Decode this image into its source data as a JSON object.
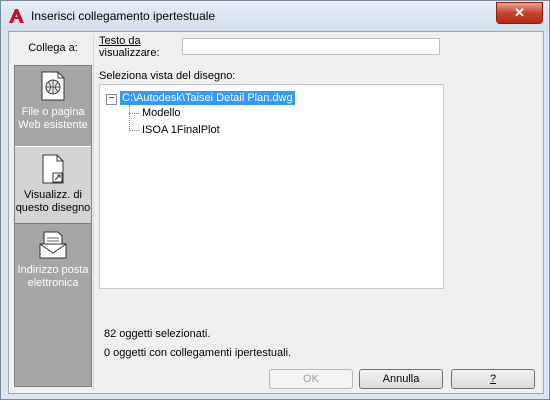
{
  "window": {
    "title": "Inserisci collegamento ipertestuale",
    "close_icon": "close-icon"
  },
  "left_panel": {
    "label": "Collega a:",
    "items": [
      {
        "label": "File o pagina Web esistente",
        "icon": "web-file-icon",
        "selected": false
      },
      {
        "label": "Visualizz. di questo disegno",
        "icon": "drawing-view-icon",
        "selected": true
      },
      {
        "label": "Indirizzo posta elettronica",
        "icon": "email-icon",
        "selected": false
      }
    ]
  },
  "display_text": {
    "label_line1": "Testo da",
    "label_line2": "visualizzare:",
    "value": ""
  },
  "tree": {
    "label": "Seleziona vista del disegno:",
    "root": "C:\\Autodesk\\Taisei Detail Plan.dwg",
    "children": [
      "Modello",
      "ISOA 1FinalPlot"
    ]
  },
  "status": {
    "line1": "82 oggetti selezionati.",
    "line2": "0 oggetti con collegamenti ipertestuali."
  },
  "buttons": {
    "ok": "OK",
    "cancel": "Annulla",
    "help": "?"
  },
  "colors": {
    "selection": "#3399ff",
    "sidebar": "#a6a6a6"
  }
}
